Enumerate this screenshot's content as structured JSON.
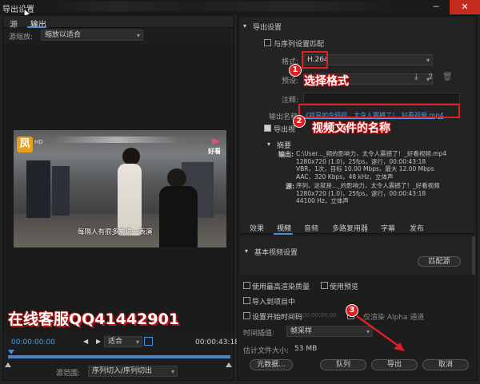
{
  "window": {
    "title": "导出设置",
    "close_glyph": "✕",
    "minimize_glyph": "─"
  },
  "left": {
    "tabs": [
      "源",
      "输出"
    ],
    "scale_label": "源缩放:",
    "scale_value": "缩放以适合",
    "video": {
      "logo_left": "凤",
      "hd": "HD",
      "logo_right_label": "好看",
      "subtitle": "每隔人有很多来说一表演"
    },
    "watermark": "在线客服QQ41442901",
    "timeline": {
      "start_tc": "00:00:00:00",
      "end_tc": "00:00:43:18",
      "fit_value": "适合",
      "range_label": "源范围:",
      "range_value": "序列切入/序列切出",
      "progress": 0
    }
  },
  "right": {
    "export_header": "导出设置",
    "match_seq_label": "与序列设置匹配",
    "format_label": "格式:",
    "format_value": "H.264",
    "preset_label": "预设:",
    "comment_label": "注释:",
    "output_name_label": "输出名称:",
    "output_name_value": "《就是如今翅视，太令人震撼了！_好看视频.mp4",
    "export_video_label": "导出视",
    "summary_header": "摘要",
    "summary_output_label": "输出:",
    "summary_output_lines": [
      "C:\\User..._频的影响力，太令人震撼了！_好看视频.mp4",
      "1280x720 (1.0)，25fps，逐行，00:00:43:18",
      "VBR，1次，目标 10.00 Mbps，最大 12.00 Mbps",
      "AAC，320 Kbps，48 kHz，立体声"
    ],
    "summary_source_label": "源:",
    "summary_source_lines": [
      "序列，这就是..._的影响力，太令人震撼了！_好看视频",
      "1280x720 (1.0)，25fps，逐行，00:00:43:18",
      "44100 Hz，立体声"
    ],
    "tabs": [
      "效果",
      "视频",
      "音频",
      "多路复用器",
      "字幕",
      "发布"
    ],
    "basic_video_header": "基本视频设置",
    "match_source_btn": "匹配源",
    "options": {
      "max_render_quality": "使用最高渲染质量",
      "use_preview": "使用预览",
      "import_project": "导入到项目中",
      "set_start_tc": "设置开始时间码",
      "start_tc_value": "00;00;00;00",
      "alpha_only": "仅渲染 Alpha 通道",
      "time_interp_label": "时间插值:",
      "time_interp_value": "帧采样",
      "est_size_label": "估计文件大小:",
      "est_size_value": "53 MB"
    },
    "buttons": {
      "metadata": "元数据...",
      "queue": "队列",
      "export": "导出",
      "cancel": "取消"
    }
  },
  "annotations": {
    "step1_num": "1",
    "step1_text": "选择格式",
    "step2_num": "2",
    "step2_text": "视频文件的名称",
    "step3_num": "3"
  },
  "colors": {
    "accent": "#4a8fd8",
    "annotation_red": "#e02020",
    "close_red": "#c42b1c"
  }
}
